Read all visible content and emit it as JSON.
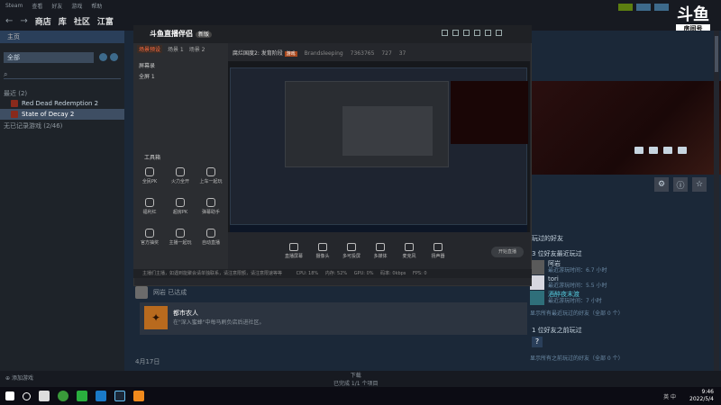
{
  "steam": {
    "menu": [
      "Steam",
      "查看",
      "好友",
      "游戏",
      "帮助"
    ],
    "nav": {
      "back": "←",
      "forward": "→",
      "store": "商店",
      "library": "库",
      "community": "社区",
      "user": "江富"
    },
    "sidebar": {
      "home": "主页",
      "filter": "全部",
      "search_placeholder": "",
      "section_recent": "最近",
      "section_recent_count": "(2)",
      "games": [
        {
          "name": "Red Dead Redemption 2",
          "selected": false
        },
        {
          "name": "State of Decay 2",
          "selected": true
        }
      ],
      "section_uncategorized": "无已记录游戏",
      "section_uncategorized_count": "(2/46)",
      "add_game": "添加游戏"
    },
    "bottom": {
      "downloads_label": "下载",
      "downloads_sub": "已完成 1/1 个项目"
    },
    "friends_panel": {
      "heading": "玩过的好友",
      "sub_heading": "3 位好友最近玩过",
      "friends": [
        {
          "name": "阿岩",
          "time": "最近游玩时间：6.7 小时",
          "online": false
        },
        {
          "name": "tori",
          "time": "最近游玩时间：5.5 小时",
          "online": false
        },
        {
          "name": "酒醉夜末渡",
          "time": "最近游玩时间：7 小时",
          "online": true
        }
      ],
      "show_all_recent": "显示所有最近玩过的好友（全部 0 个）",
      "previously_heading": "1 位好友之前玩过",
      "show_all_previous": "显示所有之前玩过的好友（全部 0 个）"
    },
    "activity": {
      "user_line": "网岩 已达成",
      "achievement_title": "都市农人",
      "achievement_desc": "在\"深入蜜蜂\"中每马刷负店后进社区。",
      "date": "4月17日"
    }
  },
  "douyu": {
    "logo": "斗鱼直播伴侣",
    "logo_tag": "新版",
    "scenes": [
      "场景预设",
      "场景 1",
      "场景 2"
    ],
    "sources": [
      "屏幕录",
      "全屏 1"
    ],
    "room_title": "腐烂国度2: 发育阶段",
    "room_tag": "游戏",
    "room_sub": "Brandsleeping",
    "room_id": "7363765",
    "room_level": "直播封面",
    "viewers": "727",
    "fans": "37",
    "toolbox_title": "工具箱",
    "tools": [
      "全民PK",
      "火力全开",
      "上车一起玩",
      "福利红",
      "超房PK",
      "弹幕助手",
      "官方抽奖",
      "主播一起玩",
      "自动直播"
    ],
    "controls": [
      "直播屏幕",
      "摄像头",
      "多可投屏",
      "多媒体",
      "麦克风",
      "扬声器"
    ],
    "live_button": "开始直播",
    "status_bar": "主播们主播，如遇到能聚会请单独联系，请注意限额，请注意限速等等",
    "stats": [
      "CPU: 18%",
      "内存: 52%",
      "GPU: 0%",
      "码率: 0kbps",
      "FPS: 0"
    ]
  },
  "douyu_badge": {
    "logo": "斗鱼",
    "label": "房间号",
    "room": "7363765"
  },
  "windows": {
    "time": "9:46",
    "date": "2022/5/4",
    "tray": "英 中"
  }
}
